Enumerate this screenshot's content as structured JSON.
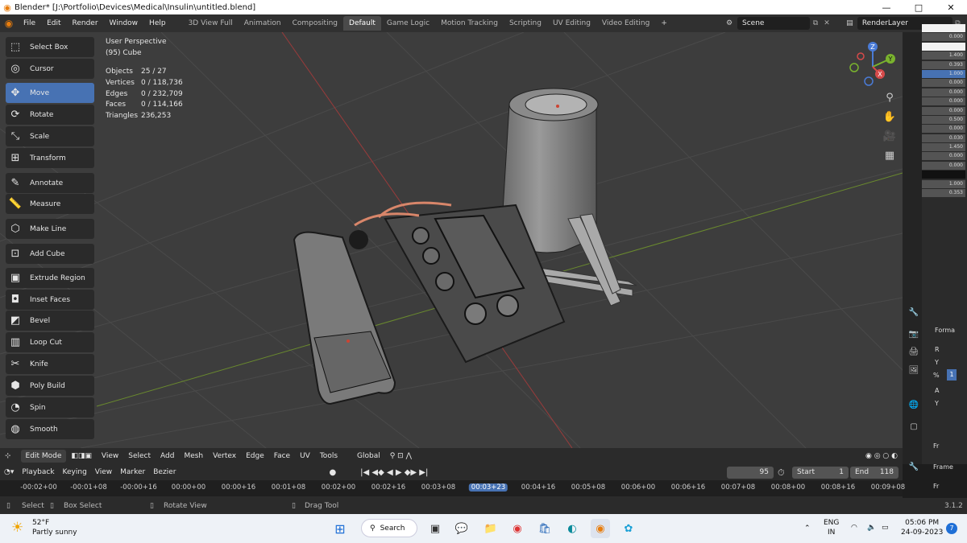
{
  "window": {
    "title": "Blender* [J:\\Portfolio\\Devices\\Medical\\Insulin\\untitled.blend]",
    "controls": {
      "minimize": "—",
      "maximize": "□",
      "close": "✕"
    }
  },
  "menu": [
    "File",
    "Edit",
    "Render",
    "Window",
    "Help"
  ],
  "workspaces": [
    "3D View Full",
    "Animation",
    "Compositing",
    "Default",
    "Game Logic",
    "Motion Tracking",
    "Scripting",
    "UV Editing",
    "Video Editing"
  ],
  "active_workspace": "Default",
  "scene": "Scene",
  "render_layer": "RenderLayer",
  "viewport": {
    "perspective": "User Perspective",
    "object": "(95) Cube",
    "stats": [
      {
        "k": "Objects",
        "v": "25 / 27"
      },
      {
        "k": "Vertices",
        "v": "0 / 118,736"
      },
      {
        "k": "Edges",
        "v": "0 / 232,709"
      },
      {
        "k": "Faces",
        "v": "0 / 114,166"
      },
      {
        "k": "Triangles",
        "v": "236,253"
      }
    ],
    "gizmo": {
      "x": "X",
      "y": "Y",
      "z": "Z"
    }
  },
  "tools": [
    "Select Box",
    "Cursor",
    "Move",
    "Rotate",
    "Scale",
    "Transform",
    "Annotate",
    "Measure",
    "Make Line",
    "Add Cube",
    "Extrude Region",
    "Inset Faces",
    "Bevel",
    "Loop Cut",
    "Knife",
    "Poly Build",
    "Spin",
    "Smooth"
  ],
  "active_tool": "Move",
  "viewport_header": {
    "mode": "Edit Mode",
    "menus": [
      "View",
      "Select",
      "Add",
      "Mesh",
      "Vertex",
      "Edge",
      "Face",
      "UV",
      "Tools"
    ],
    "orientation": "Global"
  },
  "timeline": {
    "menus": [
      "Playback",
      "Keying",
      "View",
      "Marker"
    ],
    "interpolation": "Bezier",
    "current_frame": "95",
    "start_label": "Start",
    "start": "1",
    "end_label": "End",
    "end": "118",
    "ticks": [
      "-00:02+00",
      "-00:01+08",
      "-00:00+16",
      "00:00+00",
      "00:00+16",
      "00:01+08",
      "00:02+00",
      "00:02+16",
      "00:03+08",
      "00:03+23",
      "00:04+16",
      "00:05+08",
      "00:06+00",
      "00:06+16",
      "00:07+08",
      "00:08+00",
      "00:08+16",
      "00:09+08"
    ],
    "current_time": "00:03+23"
  },
  "statusbar": {
    "select": "Select",
    "box_select": "Box Select",
    "rotate_view": "Rotate View",
    "drag_tool": "Drag Tool",
    "version": "3.1.2"
  },
  "properties": {
    "values": [
      "",
      "0.000",
      "",
      "1.400",
      "0.393",
      "1.000",
      "0.000",
      "0.000",
      "0.000",
      "0.000",
      "0.500",
      "0.000",
      "0.030",
      "1.450",
      "0.000",
      "0.000",
      "",
      "1.000",
      "0.353"
    ],
    "labels": {
      "format": "Forma",
      "r": "R",
      "y": "Y",
      "pct": "%",
      "a": "A",
      "y2": "Y",
      "fr": "Fr",
      "frame": "Frame",
      "fr2": "Fr",
      "f": "F",
      "one": "1"
    }
  },
  "taskbar": {
    "temp": "52°F",
    "weather": "Partly sunny",
    "search": "Search",
    "lang": "ENG",
    "region": "IN",
    "time": "05:06 PM",
    "date": "24-09-2023",
    "badge": "7"
  }
}
